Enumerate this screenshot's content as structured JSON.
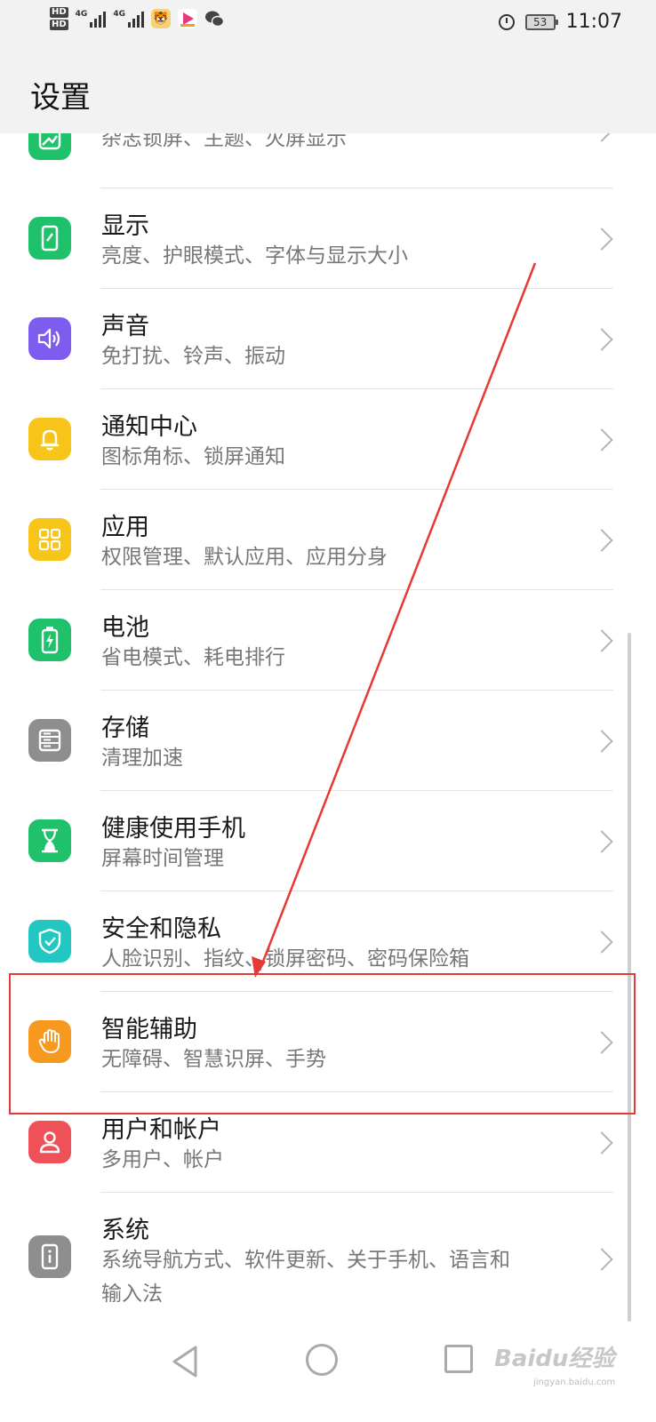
{
  "status_bar": {
    "hd1": "HD",
    "hd2": "HD",
    "net1": "4G",
    "net2": "4G",
    "battery": "53",
    "time": "11:07"
  },
  "header": {
    "title": "设置"
  },
  "items": [
    {
      "title": "",
      "subtitle": "杂志锁屏、主题、灭屏显示",
      "icon": "picture-frame-icon",
      "color": "#1fc16a"
    },
    {
      "title": "显示",
      "subtitle": "亮度、护眼模式、字体与显示大小",
      "icon": "phone-display-icon",
      "color": "#1fc16a"
    },
    {
      "title": "声音",
      "subtitle": "免打扰、铃声、振动",
      "icon": "speaker-icon",
      "color": "#7e5cf0"
    },
    {
      "title": "通知中心",
      "subtitle": "图标角标、锁屏通知",
      "icon": "bell-icon",
      "color": "#f7c51a"
    },
    {
      "title": "应用",
      "subtitle": "权限管理、默认应用、应用分身",
      "icon": "apps-grid-icon",
      "color": "#f7c51a"
    },
    {
      "title": "电池",
      "subtitle": "省电模式、耗电排行",
      "icon": "battery-icon",
      "color": "#1fc16a"
    },
    {
      "title": "存储",
      "subtitle": "清理加速",
      "icon": "storage-icon",
      "color": "#8e8e8e"
    },
    {
      "title": "健康使用手机",
      "subtitle": "屏幕时间管理",
      "icon": "hourglass-icon",
      "color": "#1fc16a"
    },
    {
      "title": "安全和隐私",
      "subtitle": "人脸识别、指纹、锁屏密码、密码保险箱",
      "icon": "shield-check-icon",
      "color": "#22c7c2"
    },
    {
      "title": "智能辅助",
      "subtitle": "无障碍、智慧识屏、手势",
      "icon": "hand-icon",
      "color": "#f7991e"
    },
    {
      "title": "用户和帐户",
      "subtitle": "多用户、帐户",
      "icon": "user-icon",
      "color": "#ee5158"
    },
    {
      "title": "系统",
      "subtitle": "系统导航方式、软件更新、关于手机、语言和",
      "subtitle2": "输入法",
      "icon": "info-phone-icon",
      "color": "#8e8e8e"
    }
  ],
  "watermark": {
    "text": "Baidu经验",
    "url": "jingyan.baidu.com"
  },
  "annotation_color": "#e53935"
}
